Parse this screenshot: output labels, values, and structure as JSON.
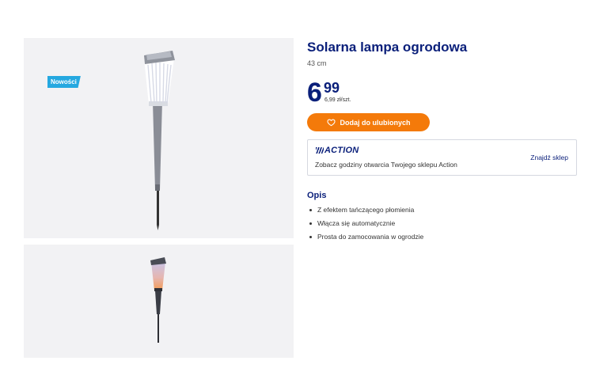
{
  "badge": {
    "label": "Nowości"
  },
  "product": {
    "title": "Solarna lampa ogrodowa",
    "size": "43 cm",
    "price_int": "6",
    "price_dec": "99",
    "price_unit": "6,99 zł/szt."
  },
  "actions": {
    "favorite_label": "Dodaj do ulubionych"
  },
  "store": {
    "logo": "ACTION",
    "text": "Zobacz godziny otwarcia Twojego sklepu Action",
    "link": "Znajdź sklep"
  },
  "description": {
    "title": "Opis",
    "items": [
      "Z efektem tańczącego płomienia",
      "Włącza się automatycznie",
      "Prosta do zamocowania w ogrodzie"
    ]
  },
  "colors": {
    "brand": "#0a1f7a",
    "accent": "#f47a0a",
    "badge": "#25a8e0"
  },
  "icons": {
    "favorite": "heart-icon"
  }
}
